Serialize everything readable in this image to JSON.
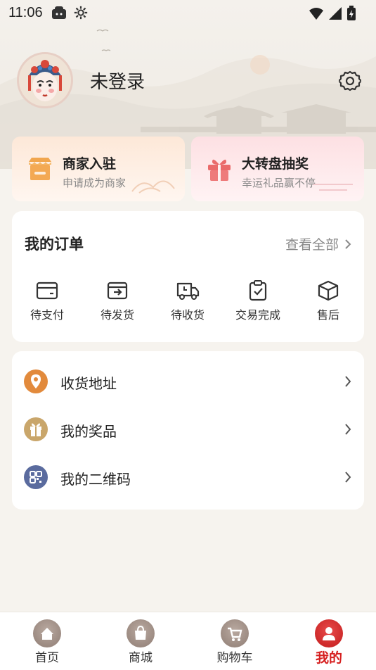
{
  "status_bar": {
    "time": "11:06"
  },
  "profile": {
    "username": "未登录"
  },
  "promos": [
    {
      "title": "商家入驻",
      "subtitle": "申请成为商家",
      "icon": "shop-icon"
    },
    {
      "title": "大转盘抽奖",
      "subtitle": "幸运礼品赢不停",
      "icon": "gift-icon"
    }
  ],
  "orders": {
    "title": "我的订单",
    "view_all": "查看全部",
    "items": [
      {
        "label": "待支付",
        "icon": "wallet-icon"
      },
      {
        "label": "待发货",
        "icon": "shipping-box-icon"
      },
      {
        "label": "待收货",
        "icon": "delivery-truck-icon"
      },
      {
        "label": "交易完成",
        "icon": "clipboard-check-icon"
      },
      {
        "label": "售后",
        "icon": "package-icon"
      }
    ]
  },
  "menu": [
    {
      "label": "收货地址",
      "icon": "location-pin-icon",
      "color": "#e28a3c"
    },
    {
      "label": "我的奖品",
      "icon": "gift-icon",
      "color": "#c9a66b"
    },
    {
      "label": "我的二维码",
      "icon": "qr-code-icon",
      "color": "#5a6b9e"
    }
  ],
  "tabs": [
    {
      "label": "首页",
      "icon": "home-icon"
    },
    {
      "label": "商城",
      "icon": "shop-bag-icon"
    },
    {
      "label": "购物车",
      "icon": "cart-icon"
    },
    {
      "label": "我的",
      "icon": "user-icon",
      "active": true
    }
  ],
  "colors": {
    "accent": "#d61f1f",
    "background": "#f6f3ee",
    "muted_text": "#8a8a8a"
  }
}
